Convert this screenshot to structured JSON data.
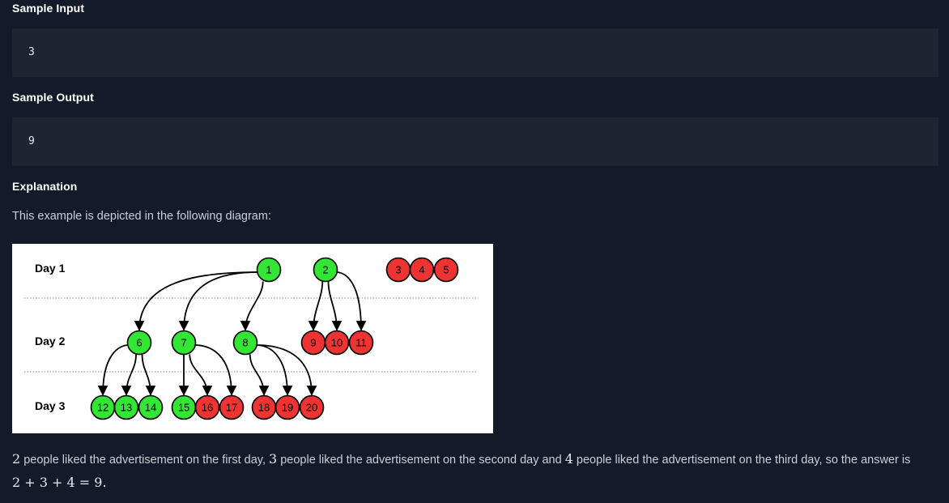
{
  "sample_input": {
    "heading": "Sample Input",
    "value": "3"
  },
  "sample_output": {
    "heading": "Sample Output",
    "value": "9"
  },
  "explanation": {
    "heading": "Explanation",
    "intro": "This example is depicted in the following diagram:",
    "diagram": {
      "day_labels": [
        "Day 1",
        "Day 2",
        "Day 3"
      ],
      "colors": {
        "liked": "#33e633",
        "not_liked": "#ee3333"
      },
      "nodes": [
        {
          "id": "1",
          "day": 1,
          "liked": true
        },
        {
          "id": "2",
          "day": 1,
          "liked": true
        },
        {
          "id": "3",
          "day": 1,
          "liked": false
        },
        {
          "id": "4",
          "day": 1,
          "liked": false
        },
        {
          "id": "5",
          "day": 1,
          "liked": false
        },
        {
          "id": "6",
          "day": 2,
          "liked": true
        },
        {
          "id": "7",
          "day": 2,
          "liked": true
        },
        {
          "id": "8",
          "day": 2,
          "liked": true
        },
        {
          "id": "9",
          "day": 2,
          "liked": false
        },
        {
          "id": "10",
          "day": 2,
          "liked": false
        },
        {
          "id": "11",
          "day": 2,
          "liked": false
        },
        {
          "id": "12",
          "day": 3,
          "liked": true
        },
        {
          "id": "13",
          "day": 3,
          "liked": true
        },
        {
          "id": "14",
          "day": 3,
          "liked": true
        },
        {
          "id": "15",
          "day": 3,
          "liked": true
        },
        {
          "id": "16",
          "day": 3,
          "liked": false
        },
        {
          "id": "17",
          "day": 3,
          "liked": false
        },
        {
          "id": "18",
          "day": 3,
          "liked": false
        },
        {
          "id": "19",
          "day": 3,
          "liked": false
        },
        {
          "id": "20",
          "day": 3,
          "liked": false
        }
      ],
      "edges": [
        [
          "1",
          "6"
        ],
        [
          "1",
          "7"
        ],
        [
          "1",
          "8"
        ],
        [
          "2",
          "9"
        ],
        [
          "2",
          "10"
        ],
        [
          "2",
          "11"
        ],
        [
          "6",
          "12"
        ],
        [
          "6",
          "13"
        ],
        [
          "6",
          "14"
        ],
        [
          "7",
          "15"
        ],
        [
          "7",
          "16"
        ],
        [
          "7",
          "17"
        ],
        [
          "8",
          "18"
        ],
        [
          "8",
          "19"
        ],
        [
          "8",
          "20"
        ]
      ]
    },
    "answer": {
      "n1": "2",
      "t1": " people liked the advertisement on the first day, ",
      "n2": "3",
      "t2": " people liked the advertisement on the second day and ",
      "n3": "4",
      "t3": " people liked the advertisement on the third day, so the answer is",
      "equation": "2 + 3 + 4 = 9."
    }
  }
}
